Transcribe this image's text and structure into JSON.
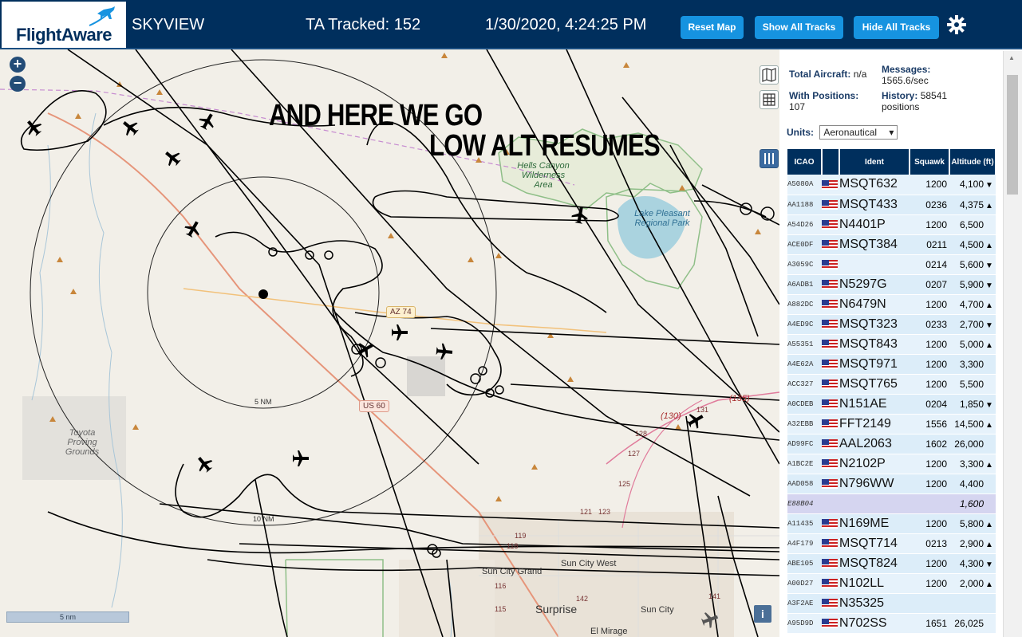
{
  "header": {
    "logo_text": "FlightAware",
    "app_name": "SKYVIEW",
    "tracked": "TA Tracked: 152",
    "datetime": "1/30/2020, 4:24:25 PM",
    "buttons": {
      "reset": "Reset Map",
      "show": "Show All Tracks",
      "hide": "Hide All Tracks"
    }
  },
  "map": {
    "annotation_line1": "AND HERE WE GO",
    "annotation_line2": "LOW ALT RESUMES",
    "labels": {
      "hells_canyon": "Hells Canyon Wilderness Area",
      "lake_pleasant": "Lake Pleasant Regional Park",
      "toyota": "Toyota Proving Grounds",
      "sun_city_grand": "Sun City Grand",
      "sun_city_west": "Sun City West",
      "sun_city": "Sun City",
      "surprise": "Surprise",
      "el_mirage": "El Mirage",
      "ring_5": "5 NM",
      "ring_10": "10 NM",
      "az74": "AZ 74",
      "us60": "US 60",
      "route_130": "(130)",
      "route_135": "(135)",
      "num_131": "131",
      "num_128": "128",
      "num_127": "127",
      "num_125": "125",
      "num_123": "123",
      "num_121": "121",
      "num_119": "119",
      "num_118": "118",
      "num_116": "116",
      "num_115": "115",
      "num_142": "142",
      "num_141": "141"
    },
    "scale": "5 nm",
    "info_button": "i",
    "zoom_in": "+",
    "zoom_out": "−"
  },
  "panel": {
    "total_aircraft_label": "Total Aircraft:",
    "total_aircraft_value": "n/a",
    "messages_label": "Messages:",
    "messages_value": "1565.6/sec",
    "positions_label": "With Positions:",
    "positions_value": "107",
    "history_label": "History:",
    "history_value": "58541 positions",
    "units_label": "Units:",
    "units_value": "Aeronautical",
    "columns": [
      "ICAO",
      "",
      "Ident",
      "Squawk",
      "Altitude (ft)"
    ],
    "rows": [
      {
        "icao": "A5080A",
        "flag": true,
        "ident": "MSQT632",
        "squawk": "1200",
        "alt": "4,100",
        "trend": "▼"
      },
      {
        "icao": "AA1188",
        "flag": true,
        "ident": "MSQT433",
        "squawk": "0236",
        "alt": "4,375",
        "trend": "▲"
      },
      {
        "icao": "A54D26",
        "flag": true,
        "ident": "N4401P",
        "squawk": "1200",
        "alt": "6,500",
        "trend": ""
      },
      {
        "icao": "ACE0DF",
        "flag": true,
        "ident": "MSQT384",
        "squawk": "0211",
        "alt": "4,500",
        "trend": "▲"
      },
      {
        "icao": "A3059C",
        "flag": true,
        "ident": "",
        "squawk": "0214",
        "alt": "5,600",
        "trend": "▼"
      },
      {
        "icao": "A6ADB1",
        "flag": true,
        "ident": "N5297G",
        "squawk": "0207",
        "alt": "5,900",
        "trend": "▼"
      },
      {
        "icao": "A882DC",
        "flag": true,
        "ident": "N6479N",
        "squawk": "1200",
        "alt": "4,700",
        "trend": "▲"
      },
      {
        "icao": "A4ED9C",
        "flag": true,
        "ident": "MSQT323",
        "squawk": "0233",
        "alt": "2,700",
        "trend": "▼"
      },
      {
        "icao": "A55351",
        "flag": true,
        "ident": "MSQT843",
        "squawk": "1200",
        "alt": "5,000",
        "trend": "▲"
      },
      {
        "icao": "A4E62A",
        "flag": true,
        "ident": "MSQT971",
        "squawk": "1200",
        "alt": "3,300",
        "trend": ""
      },
      {
        "icao": "ACC327",
        "flag": true,
        "ident": "MSQT765",
        "squawk": "1200",
        "alt": "5,500",
        "trend": ""
      },
      {
        "icao": "A0CDEB",
        "flag": true,
        "ident": "N151AE",
        "squawk": "0204",
        "alt": "1,850",
        "trend": "▼"
      },
      {
        "icao": "A32EBB",
        "flag": true,
        "ident": "FFT2149",
        "squawk": "1556",
        "alt": "14,500",
        "trend": "▲"
      },
      {
        "icao": "AD99FC",
        "flag": true,
        "ident": "AAL2063",
        "squawk": "1602",
        "alt": "26,000",
        "trend": ""
      },
      {
        "icao": "A1BC2E",
        "flag": true,
        "ident": "N2102P",
        "squawk": "1200",
        "alt": "3,300",
        "trend": "▲"
      },
      {
        "icao": "AAD058",
        "flag": true,
        "ident": "N796WW",
        "squawk": "1200",
        "alt": "4,400",
        "trend": ""
      },
      {
        "icao": "E88B04",
        "flag": false,
        "ident": "",
        "squawk": "",
        "alt": "1,600",
        "trend": "",
        "selected": true
      },
      {
        "icao": "A11435",
        "flag": true,
        "ident": "N169ME",
        "squawk": "1200",
        "alt": "5,800",
        "trend": "▲"
      },
      {
        "icao": "A4F179",
        "flag": true,
        "ident": "MSQT714",
        "squawk": "0213",
        "alt": "2,900",
        "trend": "▲"
      },
      {
        "icao": "ABE105",
        "flag": true,
        "ident": "MSQT824",
        "squawk": "1200",
        "alt": "4,300",
        "trend": "▼"
      },
      {
        "icao": "A00D27",
        "flag": true,
        "ident": "N102LL",
        "squawk": "1200",
        "alt": "2,000",
        "trend": "▲"
      },
      {
        "icao": "A3F2AE",
        "flag": true,
        "ident": "N35325",
        "squawk": "",
        "alt": "",
        "trend": ""
      },
      {
        "icao": "A95D9D",
        "flag": true,
        "ident": "N702SS",
        "squawk": "1651",
        "alt": "26,025",
        "trend": ""
      }
    ]
  }
}
